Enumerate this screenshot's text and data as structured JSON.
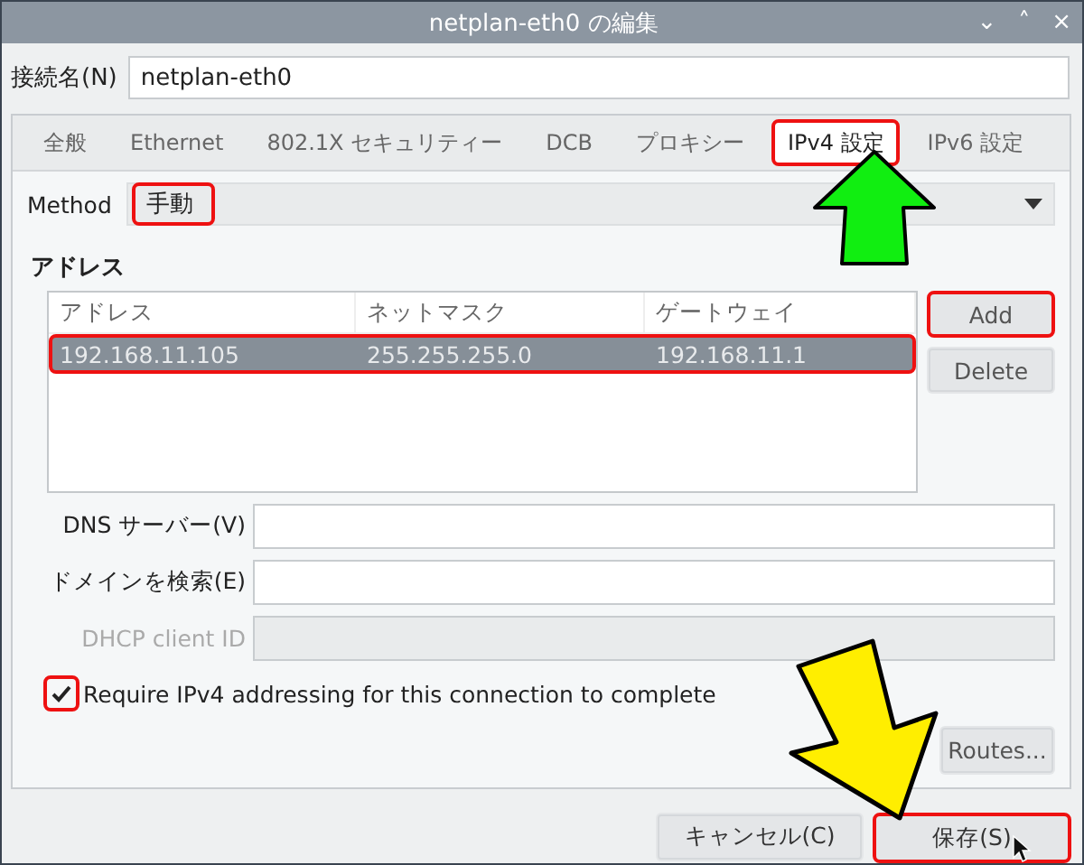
{
  "window": {
    "title": "netplan-eth0 の編集",
    "controls": [
      "⌄",
      "˄",
      "×"
    ]
  },
  "connection_name": {
    "label": "接続名(N)",
    "value": "netplan-eth0"
  },
  "tabs": [
    {
      "label": "全般",
      "selected": false,
      "highlighted": false
    },
    {
      "label": "Ethernet",
      "selected": false,
      "highlighted": false
    },
    {
      "label": "802.1X セキュリティー",
      "selected": false,
      "highlighted": false
    },
    {
      "label": "DCB",
      "selected": false,
      "highlighted": false
    },
    {
      "label": "プロキシー",
      "selected": false,
      "highlighted": false
    },
    {
      "label": "IPv4 設定",
      "selected": true,
      "highlighted": true
    },
    {
      "label": "IPv6 設定",
      "selected": false,
      "highlighted": false
    }
  ],
  "method": {
    "label": "Method",
    "value": "手動",
    "highlighted": true
  },
  "addresses": {
    "title": "アドレス",
    "columns": [
      "アドレス",
      "ネットマスク",
      "ゲートウェイ"
    ],
    "rows": [
      {
        "cells": [
          "192.168.11.105",
          "255.255.255.0",
          "192.168.11.1"
        ],
        "selected": true,
        "highlighted": true
      }
    ],
    "buttons": [
      {
        "label": "Add",
        "disabled": false,
        "highlighted": true
      },
      {
        "label": "Delete",
        "disabled": false,
        "highlighted": false
      }
    ]
  },
  "fields": [
    {
      "label": "DNS サーバー(V)",
      "disabled": false
    },
    {
      "label": "ドメインを検索(E)",
      "disabled": false
    },
    {
      "label": "DHCP client ID",
      "disabled": true
    }
  ],
  "require_checkbox": {
    "label": "Require IPv4 addressing for this connection to complete",
    "checked": true,
    "highlighted": true
  },
  "routes_button": {
    "label": "Routes..."
  },
  "footer_buttons": [
    {
      "label": "キャンセル(C)",
      "highlighted": false
    },
    {
      "label": "保存(S)",
      "highlighted": true
    }
  ]
}
